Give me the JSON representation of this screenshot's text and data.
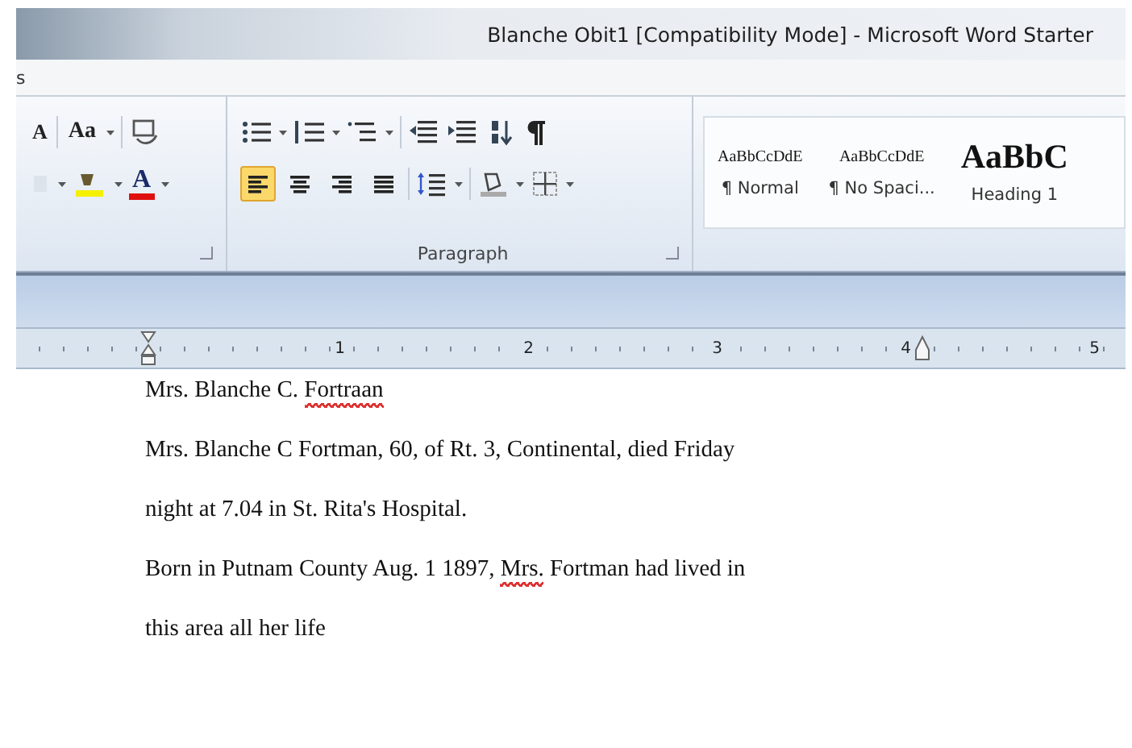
{
  "window": {
    "title": "Blanche Obit1 [Compatibility Mode] - Microsoft Word Starter"
  },
  "tab_fragment": "s",
  "font_group": {
    "grow_label": "A",
    "case_label": "Aa",
    "color_label": "A"
  },
  "paragraph_group": {
    "label": "Paragraph",
    "alignments": [
      {
        "selected": true
      },
      {
        "selected": false
      },
      {
        "selected": false
      },
      {
        "selected": false
      }
    ]
  },
  "styles": [
    {
      "preview": "AaBbCcDdE",
      "name": "¶ Normal",
      "kind": "body"
    },
    {
      "preview": "AaBbCcDdE",
      "name": "¶ No Spaci...",
      "kind": "body"
    },
    {
      "preview": "AaBbC",
      "name": "Heading 1",
      "kind": "heading"
    }
  ],
  "ruler": {
    "numbers": [
      "1",
      "2",
      "3",
      "4",
      "5"
    ]
  },
  "document": {
    "lines": [
      [
        {
          "text": "Mrs. Blanche C. ",
          "misspelled": false
        },
        {
          "text": "Fortraan",
          "misspelled": true
        }
      ],
      [
        {
          "text": "Mrs. Blanche C Fortman, 60, of Rt. 3, Continental, died Friday",
          "misspelled": false
        }
      ],
      [
        {
          "text": "night at 7.04 in St. Rita's Hospital.",
          "misspelled": false
        }
      ],
      [
        {
          "text": "Born in Putnam County Aug. 1 1897, ",
          "misspelled": false
        },
        {
          "text": "Mrs.",
          "misspelled": true
        },
        {
          "text": " Fortman had lived in",
          "misspelled": false
        }
      ],
      [
        {
          "text": "this area all her life",
          "misspelled": false
        }
      ]
    ]
  }
}
